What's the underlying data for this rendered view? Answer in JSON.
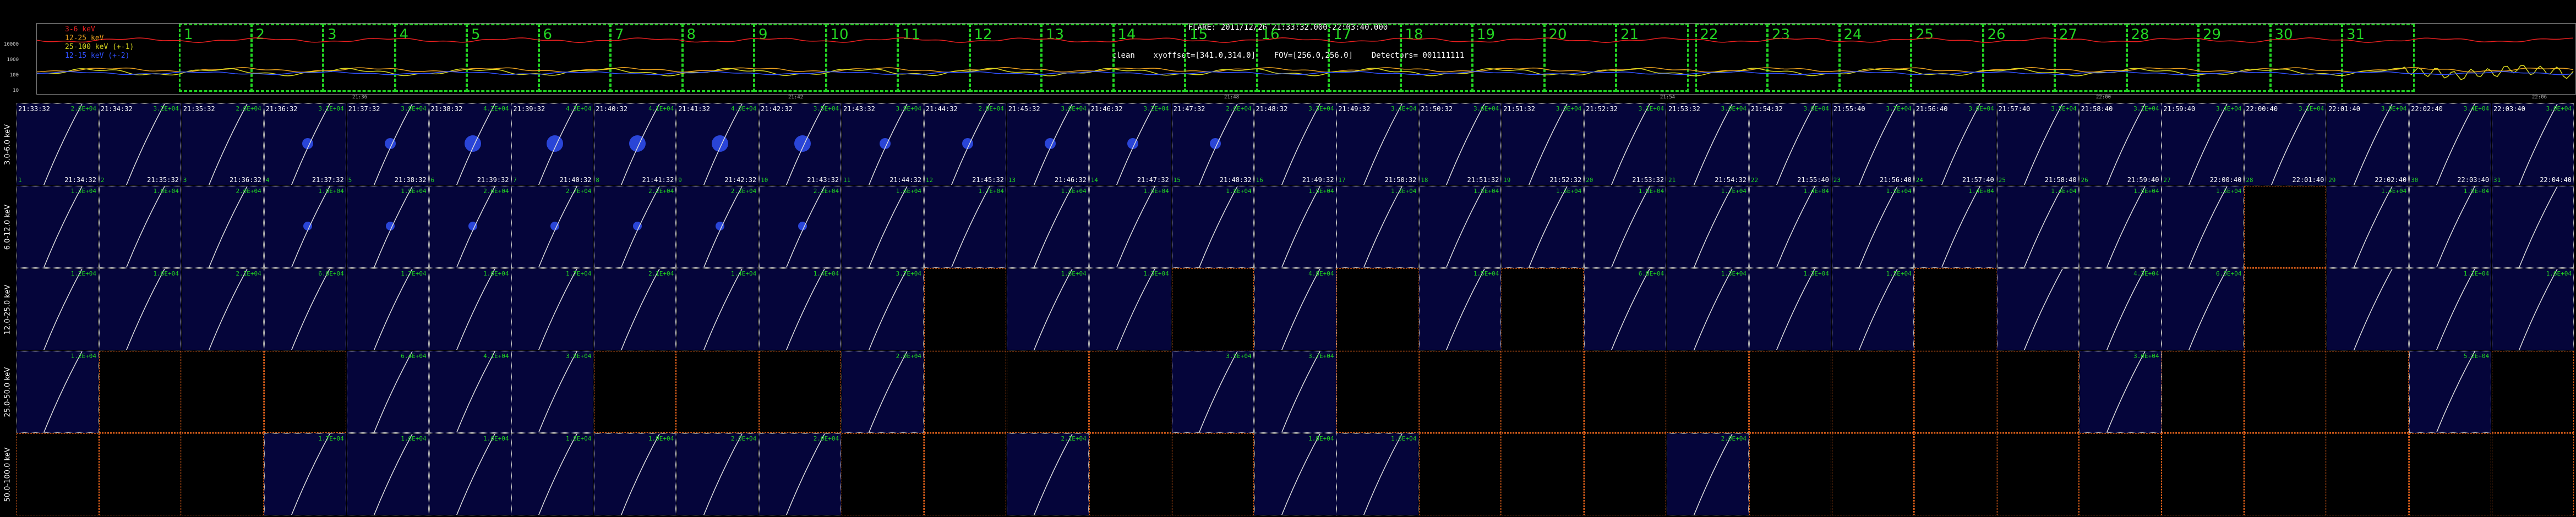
{
  "header": {
    "title_line": "FLARE: 2011/12/26 21:33:32.000-22:03:40.000",
    "params_line": "clean    xyoffset=[341.0,314.0]    FOV=[256.0,256.0]    Detectors= 001111111"
  },
  "lightcurve": {
    "y_ticks": [
      "10000",
      "1000",
      "100",
      "10"
    ],
    "legend": [
      {
        "label": "3-6 keV",
        "color": "#e82020"
      },
      {
        "label": "12-25 keV",
        "color": "#e8a020"
      },
      {
        "label": "25-100 keV (+-1)",
        "color": "#d8d820"
      },
      {
        "label": "12-15 keV (+-2)",
        "color": "#3050ff"
      }
    ],
    "time_ticks": [
      "21:36",
      "21:42",
      "21:48",
      "21:54",
      "22:00",
      "22:06"
    ],
    "segments": [
      "1",
      "2",
      "3",
      "4",
      "5",
      "6",
      "7",
      "8",
      "9",
      "10",
      "11",
      "12",
      "13",
      "14",
      "15",
      "16",
      "17",
      "18",
      "19",
      "20",
      "21",
      "22",
      "23",
      "24",
      "25",
      "26",
      "27",
      "28",
      "29",
      "30",
      "31"
    ]
  },
  "rows": [
    {
      "label": "3.0-6.0 keV"
    },
    {
      "label": "6.0-12.0 keV"
    },
    {
      "label": "12.0-25.0 keV"
    },
    {
      "label": "25.0-50.0 keV"
    },
    {
      "label": "50.0-100.0 keV"
    }
  ],
  "start_times": [
    "21:33:32",
    "21:34:32",
    "21:35:32",
    "21:36:32",
    "21:37:32",
    "21:38:32",
    "21:39:32",
    "21:40:32",
    "21:41:32",
    "21:42:32",
    "21:43:32",
    "21:44:32",
    "21:45:32",
    "21:46:32",
    "21:47:32",
    "21:48:32",
    "21:49:32",
    "21:50:32",
    "21:51:32",
    "21:52:32",
    "21:53:32",
    "21:54:32",
    "21:55:40",
    "21:56:40",
    "21:57:40",
    "21:58:40",
    "21:59:40",
    "22:00:40",
    "22:01:40",
    "22:02:40",
    "22:03:40"
  ],
  "end_times": [
    "21:34:32",
    "21:35:32",
    "21:36:32",
    "21:37:32",
    "21:38:32",
    "21:39:32",
    "21:40:32",
    "21:41:32",
    "21:42:32",
    "21:43:32",
    "21:44:32",
    "21:45:32",
    "21:46:32",
    "21:47:32",
    "21:48:32",
    "21:49:32",
    "21:50:32",
    "21:51:32",
    "21:52:32",
    "21:53:32",
    "21:54:32",
    "21:55:40",
    "21:56:40",
    "21:57:40",
    "21:58:40",
    "21:59:40",
    "22:00:40",
    "22:01:40",
    "22:02:40",
    "22:03:40",
    "22:04:40"
  ],
  "flux": {
    "row0": [
      "2.6E+04",
      "3.2E+04",
      "2.6E+04",
      "3.1E+04",
      "3.9E+04",
      "4.2E+04",
      "4.3E+04",
      "4.1E+04",
      "4.0E+04",
      "3.5E+04",
      "3.9E+04",
      "2.8E+04",
      "3.0E+04",
      "3.2E+04",
      "2.6E+04",
      "3.3E+04",
      "3.4E+04",
      "3.6E+04",
      "3.0E+04",
      "3.1E+04",
      "3.0E+04",
      "3.0E+04",
      "3.7E+04",
      "3.6E+04",
      "3.5E+04",
      "3.1E+04",
      "3.4E+04",
      "3.1E+04",
      "3.9E+04",
      "3.4E+04",
      "3.0E+04"
    ],
    "row1": [
      "1.5E+04",
      "1.6E+04",
      "2.0E+04",
      "1.9E+04",
      "1.9E+04",
      "2.6E+04",
      "2.7E+04",
      "2.2E+04",
      "2.3E+04",
      "2.2E+04",
      "1.6E+04",
      "1.7E+04",
      "1.5E+04",
      "1.5E+04",
      "1.8E+04",
      "1.5E+04",
      "1.3E+04",
      "1.5E+04",
      "1.5E+04",
      "1.5E+04",
      "1.7E+04",
      "1.4E+04",
      "1.5E+04",
      "1.4E+04",
      "1.4E+04",
      "1.5E+04",
      "1.5E+04",
      "",
      "1.4E+04",
      "1.5E+04",
      ""
    ],
    "row2": [
      "1.2E+04",
      "1.6E+04",
      "2.1E+04",
      "6.0E+04",
      "1.7E+04",
      "1.6E+04",
      "1.7E+04",
      "2.1E+04",
      "1.4E+04",
      "1.4E+04",
      "3.7E+04",
      "",
      "1.6E+04",
      "1.3E+04",
      "",
      "4.8E+04",
      "",
      "1.5E+04",
      "",
      "6.8E+04",
      "1.3E+04",
      "1.3E+04",
      "1.5E+04",
      "1.7E+04",
      "",
      "4.3E+04",
      "6.0E+04",
      "8.1E+04",
      "",
      "1.1E+04",
      "1.6E+04"
    ],
    "row3": [
      "1.2E+04",
      "",
      "",
      "",
      "6.4E+04",
      "4.1E+04",
      "3.8E+04",
      "",
      "",
      "",
      "2.0E+04",
      "",
      "",
      "",
      "3.5E+04",
      "3.7E+04",
      "",
      "",
      "",
      "",
      "",
      "",
      "",
      "",
      "",
      "3.0E+04",
      "",
      "",
      "",
      "5.2E+04",
      ""
    ],
    "row4": [
      "",
      "",
      "",
      "1.7E+04",
      "1.6E+04",
      "1.6E+04",
      "1.8E+04",
      "1.9E+04",
      "2.0E+04",
      "2.0E+04",
      "",
      "",
      "2.1E+04",
      "",
      "",
      "1.8E+04",
      "1.6E+04",
      "",
      "",
      "",
      "2.0E+04",
      "",
      "",
      "",
      "",
      "",
      "",
      "",
      "",
      "",
      ""
    ]
  },
  "blank": {
    "row0": [],
    "row1": [
      27
    ],
    "row2": [
      11,
      14,
      16,
      18,
      23,
      27
    ],
    "row3": [
      1,
      2,
      3,
      7,
      8,
      9,
      11,
      12,
      13,
      16,
      17,
      18,
      19,
      20,
      21,
      22,
      23,
      24,
      26,
      27,
      28,
      30
    ],
    "row4": [
      0,
      1,
      2,
      10,
      11,
      13,
      14,
      17,
      18,
      19,
      21,
      22,
      23,
      24,
      25,
      26,
      27,
      28,
      29,
      30
    ]
  }
}
